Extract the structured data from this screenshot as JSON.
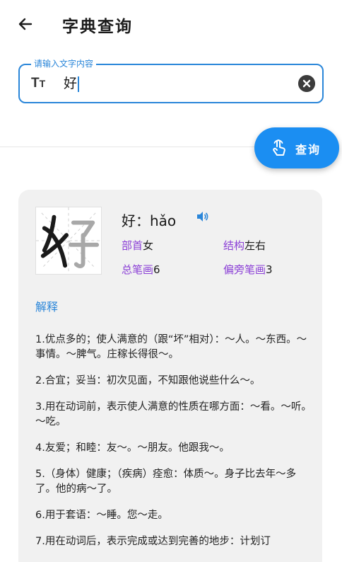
{
  "header": {
    "title": "字典查询"
  },
  "search": {
    "label": "请输入文字内容",
    "value": "好",
    "button_label": "查询"
  },
  "result": {
    "heading": "好：hǎo",
    "radical_key": "部首",
    "radical_val": "女",
    "structure_key": "结构",
    "structure_val": "左右",
    "strokes_key": "总笔画",
    "strokes_val": "6",
    "side_strokes_key": "偏旁笔画",
    "side_strokes_val": "3",
    "section_title": "解释",
    "definitions": [
      "1.优点多的；使人满意的（跟“坏”相对）：～人。～东西。～事情。～脾气。庄稼长得很～。",
      "2.合宜；妥当：初次见面，不知跟他说些什么～。",
      "3.用在动词前，表示使人满意的性质在哪方面：～看。～听。～吃。",
      "4.友爱；和睦：友～。～朋友。他跟我～。",
      "5.（身体）健康；（疾病）痊愈：体质～。身子比去年～多了。他的病～了。",
      "6.用于套语：～睡。您～走。",
      "7.用在动词后，表示完成或达到完善的地步：计划订"
    ]
  }
}
